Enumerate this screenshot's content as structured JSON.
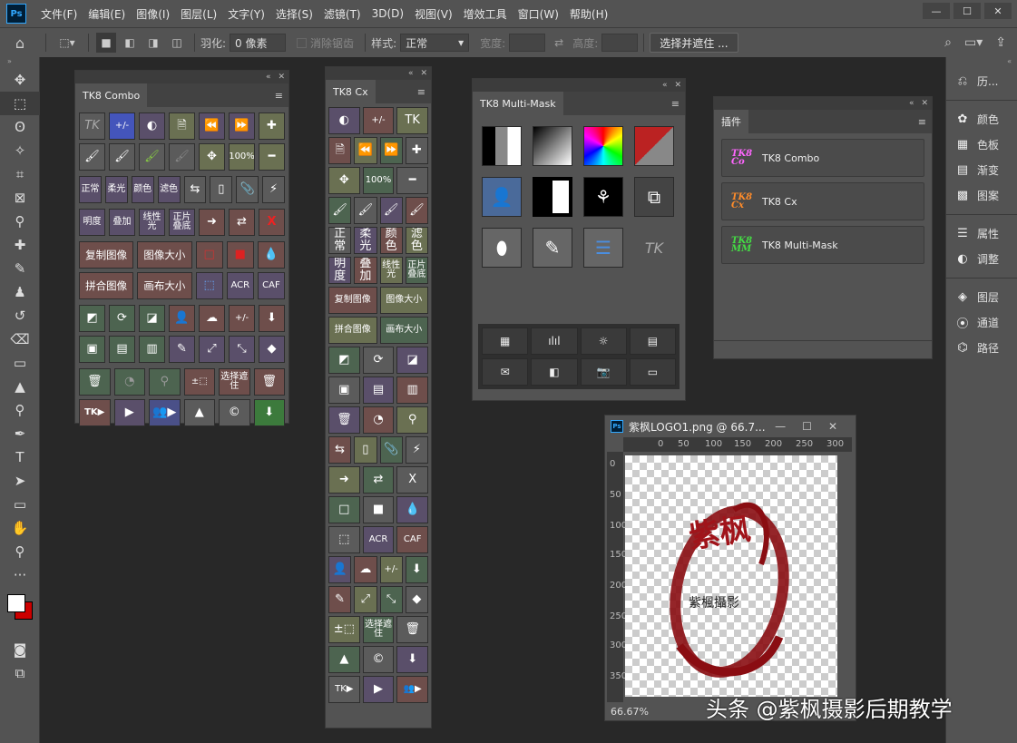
{
  "menubar": {
    "logo": "Ps",
    "items": [
      "文件(F)",
      "编辑(E)",
      "图像(I)",
      "图层(L)",
      "文字(Y)",
      "选择(S)",
      "滤镜(T)",
      "3D(D)",
      "视图(V)",
      "增效工具",
      "窗口(W)",
      "帮助(H)"
    ]
  },
  "options": {
    "feather_label": "羽化:",
    "feather_value": "0 像素",
    "antialias": "消除锯齿",
    "style_label": "样式:",
    "style_value": "正常",
    "width_label": "宽度:",
    "height_label": "高度:",
    "select_mask": "选择并遮住 ..."
  },
  "right_dock": {
    "items": [
      "历...",
      "颜色",
      "色板",
      "渐变",
      "图案",
      "属性",
      "调整",
      "图层",
      "通道",
      "路径"
    ]
  },
  "combo": {
    "tab": "TK8 Combo",
    "rows": [
      [
        "TK",
        "+/-",
        "◐",
        "🗎",
        "⏪",
        "⏩",
        "✚"
      ],
      [
        "🖌",
        "🖌",
        "🖌",
        "🖌",
        "✥",
        "100%",
        "━"
      ],
      [
        "正常",
        "柔光",
        "颜色",
        "滤色",
        "⇆",
        "▯",
        "📎",
        "⚡"
      ],
      [
        "明度",
        "叠加",
        "线性光",
        "正片叠底",
        "➜",
        "⇄",
        "X"
      ],
      [
        "复制图像",
        "图像大小",
        "□",
        "■",
        "💧"
      ],
      [
        "拼合图像",
        "画布大小",
        "⬚",
        "ACR",
        "CAF"
      ],
      [
        "◩",
        "⟳",
        "◪",
        "👤",
        "☁",
        "+/-",
        "⬇"
      ],
      [
        "▣",
        "▤",
        "▥",
        "✎",
        "⤢",
        "⤡",
        "◆"
      ],
      [
        "🗑",
        "◔",
        "⚲",
        "±⬚",
        "选择遮住",
        "🗑"
      ],
      [
        "TK▶",
        "▶",
        "👥▶",
        "▲",
        "©",
        "⬇"
      ]
    ]
  },
  "cx": {
    "tab": "TK8 Cx",
    "rows": [
      [
        "◐",
        "+/-",
        "TK"
      ],
      [
        "🗎",
        "⏪",
        "⏩",
        "✚"
      ],
      [
        "✥",
        "100%",
        "━"
      ],
      [
        "🖌",
        "🖌",
        "🖌",
        "🖌"
      ],
      [
        "正常",
        "柔光",
        "颜色",
        "滤色"
      ],
      [
        "明度",
        "叠加",
        "线性光",
        "正片叠底"
      ],
      [
        "复制图像",
        "图像大小"
      ],
      [
        "拼合图像",
        "画布大小"
      ],
      [
        "◩",
        "⟳",
        "◪"
      ],
      [
        "▣",
        "▤",
        "▥"
      ],
      [
        "🗑",
        "◔",
        "⚲"
      ],
      [
        "⇆",
        "▯",
        "📎",
        "⚡"
      ],
      [
        "➜",
        "⇄",
        "X"
      ],
      [
        "□",
        "■",
        "💧"
      ],
      [
        "⬚",
        "ACR",
        "CAF"
      ],
      [
        "👤",
        "☁",
        "+/-",
        "⬇"
      ],
      [
        "✎",
        "⤢",
        "⤡",
        "◆"
      ],
      [
        "±⬚",
        "选择遮住",
        "🗑"
      ],
      [
        "▲",
        "©",
        "⬇"
      ],
      [
        "TK▶",
        "▶",
        "👥▶"
      ]
    ]
  },
  "multimask": {
    "tab": "TK8 Multi-Mask",
    "bottom": [
      "▦",
      "ılıl",
      "☼",
      "▤",
      "✉",
      "◧",
      "📷",
      "▭"
    ]
  },
  "plugins": {
    "tab": "插件",
    "items": [
      {
        "logo": "TK8 Co",
        "name": "TK8 Combo",
        "color": "#ff66ff"
      },
      {
        "logo": "TK8 Cx",
        "name": "TK8 Cx",
        "color": "#ff8c2a"
      },
      {
        "logo": "TK8 MM",
        "name": "TK8 Multi-Mask",
        "color": "#44dd44"
      }
    ]
  },
  "document": {
    "title": "紫枫LOGO1.png @ 66.7...",
    "zoom": "66.67%",
    "ruler_h": [
      "0",
      "50",
      "100",
      "150",
      "200",
      "250",
      "300"
    ],
    "ruler_v": [
      "0",
      "50",
      "100",
      "150",
      "200",
      "250",
      "300",
      "350"
    ],
    "logo_big": "紫枫",
    "logo_small": "紫楓攝影"
  },
  "watermark": "头条 @紫枫摄影后期教学"
}
